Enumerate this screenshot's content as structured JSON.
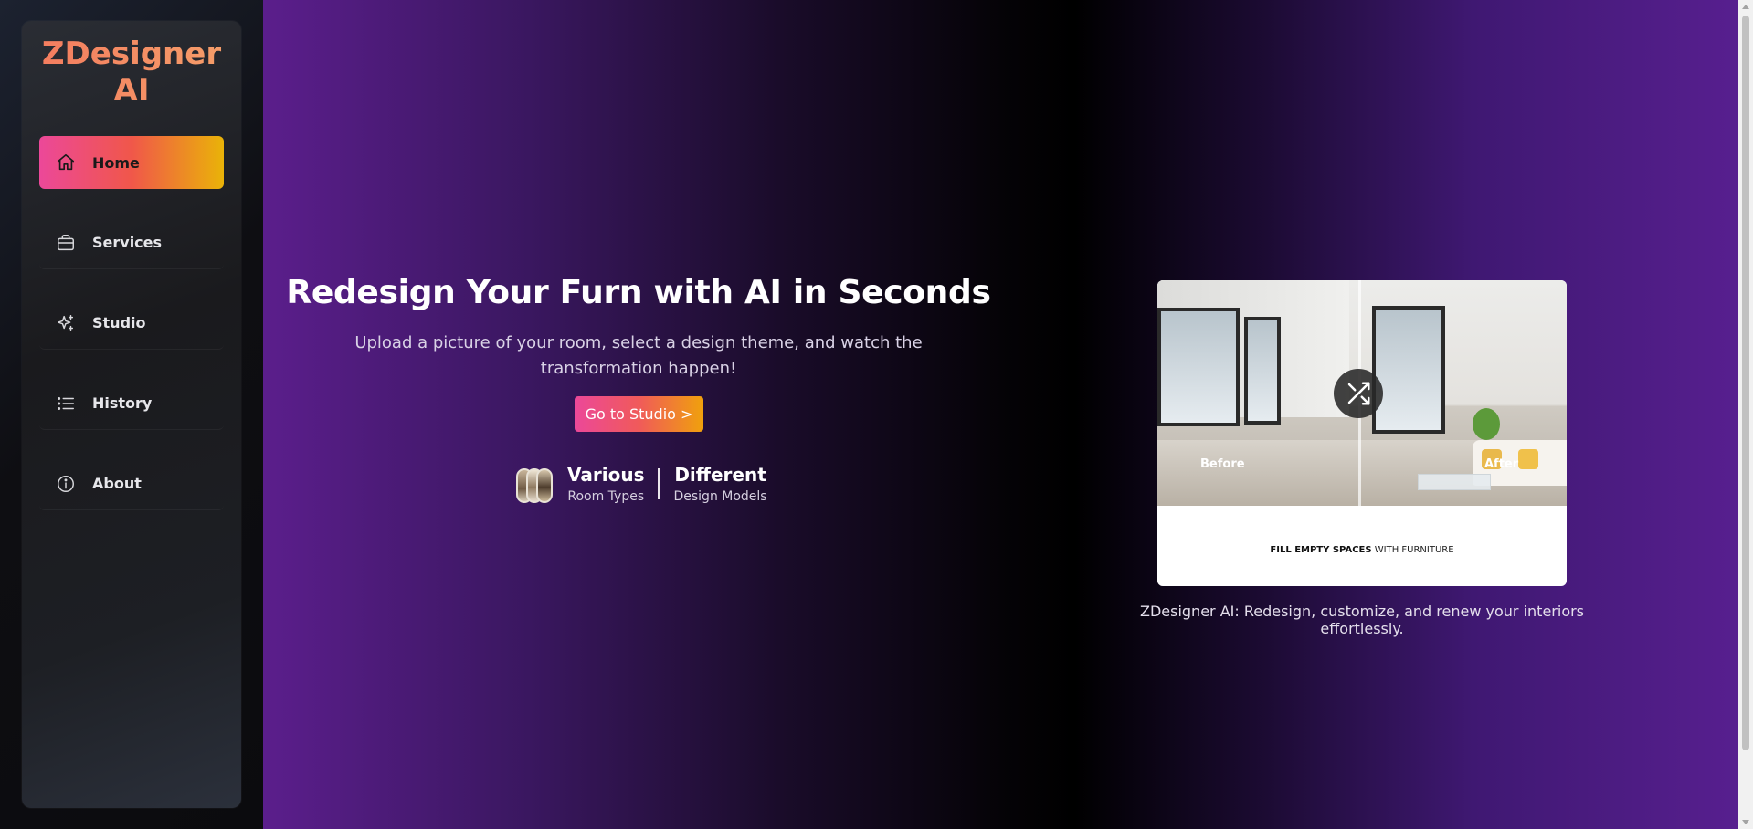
{
  "brand": {
    "name": "ZDesigner AI"
  },
  "sidebar": {
    "items": [
      {
        "label": "Home",
        "icon": "home-icon",
        "active": true
      },
      {
        "label": "Services",
        "icon": "briefcase-icon",
        "active": false
      },
      {
        "label": "Studio",
        "icon": "sparkles-icon",
        "active": false
      },
      {
        "label": "History",
        "icon": "list-icon",
        "active": false
      },
      {
        "label": "About",
        "icon": "info-icon",
        "active": false
      }
    ]
  },
  "hero": {
    "title": "Redesign Your Furn with AI in Seconds",
    "subtitle": "Upload a picture of your room, select a design theme, and watch the transformation happen!",
    "cta_label": "Go to Studio >",
    "stats": [
      {
        "big": "Various",
        "small": "Room Types"
      },
      {
        "big": "Different",
        "small": "Design Models"
      }
    ]
  },
  "preview": {
    "before_label": "Before",
    "after_label": "After",
    "caption_bold": "FILL EMPTY SPACES",
    "caption_rest": " WITH FURNITURE",
    "description": "ZDesigner AI: Redesign, customize, and renew your interiors effortlessly.",
    "swap_icon": "shuffle-icon"
  },
  "colors": {
    "accent_gradient_start": "#ec4899",
    "accent_gradient_end": "#eab308",
    "brand_text": "#f4845f",
    "background_purple": "#571f8f"
  }
}
